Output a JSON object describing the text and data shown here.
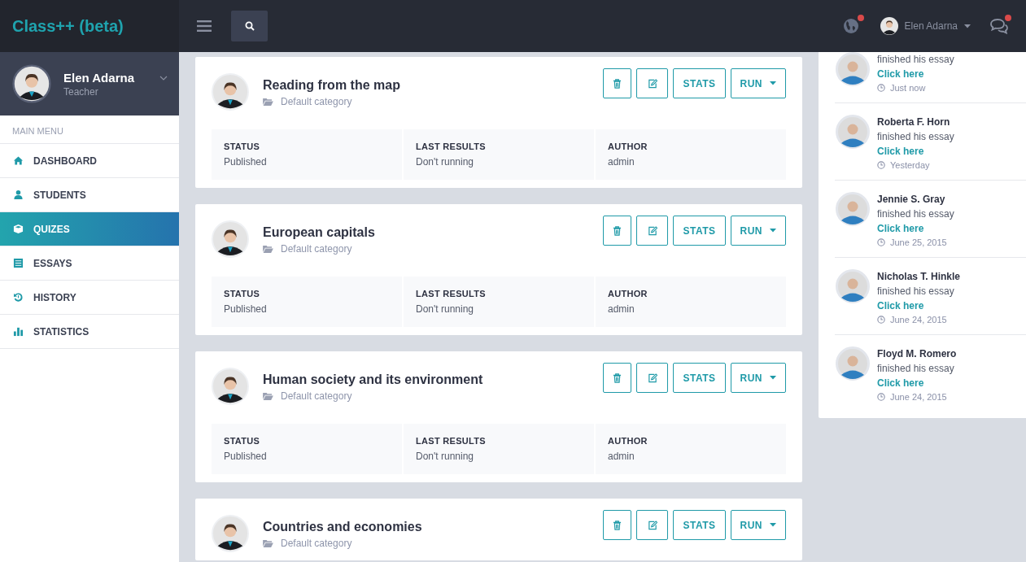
{
  "app": {
    "title": "Class++ (beta)"
  },
  "profile": {
    "name": "Elen Adarna",
    "role": "Teacher"
  },
  "menu": {
    "heading": "MAIN MENU",
    "items": [
      {
        "label": "DASHBOARD",
        "selected": false
      },
      {
        "label": "STUDENTS",
        "selected": false
      },
      {
        "label": "QUIZES",
        "selected": true
      },
      {
        "label": "ESSAYS",
        "selected": false
      },
      {
        "label": "HISTORY",
        "selected": false
      },
      {
        "label": "STATISTICS",
        "selected": false
      }
    ]
  },
  "topbar": {
    "globe": {
      "unread": true
    },
    "user": {
      "name": "Elen Adarna"
    },
    "messages": {
      "unread": true
    }
  },
  "quizzes": [
    {
      "title": "Reading from the map",
      "category": "Default category",
      "stats": "STATS",
      "run": "RUN",
      "fields": [
        {
          "label": "STATUS",
          "value": "Published"
        },
        {
          "label": "LAST RESULTS",
          "value": "Don't running"
        },
        {
          "label": "AUTHOR",
          "value": "admin"
        }
      ]
    },
    {
      "title": "European capitals",
      "category": "Default category",
      "stats": "STATS",
      "run": "RUN",
      "fields": [
        {
          "label": "STATUS",
          "value": "Published"
        },
        {
          "label": "LAST RESULTS",
          "value": "Don't running"
        },
        {
          "label": "AUTHOR",
          "value": "admin"
        }
      ]
    },
    {
      "title": "Human society and its environment",
      "category": "Default category",
      "stats": "STATS",
      "run": "RUN",
      "fields": [
        {
          "label": "STATUS",
          "value": "Published"
        },
        {
          "label": "LAST RESULTS",
          "value": "Don't running"
        },
        {
          "label": "AUTHOR",
          "value": "admin"
        }
      ]
    },
    {
      "title": "Countries and economies",
      "category": "Default category",
      "stats": "STATS",
      "run": "RUN"
    }
  ],
  "feed": [
    {
      "text": "finished his essay",
      "link": "Click here",
      "time": "Just now"
    },
    {
      "name": "Roberta F. Horn",
      "text": "finished his essay",
      "link": "Click here",
      "time": "Yesterday"
    },
    {
      "name": "Jennie S. Gray",
      "text": "finished his essay",
      "link": "Click here",
      "time": "June 25, 2015"
    },
    {
      "name": "Nicholas T. Hinkle",
      "text": "finished his essay",
      "link": "Click here",
      "time": "June 24, 2015"
    },
    {
      "name": "Floyd M. Romero",
      "text": "finished his essay",
      "link": "Click here",
      "time": "June 24, 2015"
    }
  ]
}
